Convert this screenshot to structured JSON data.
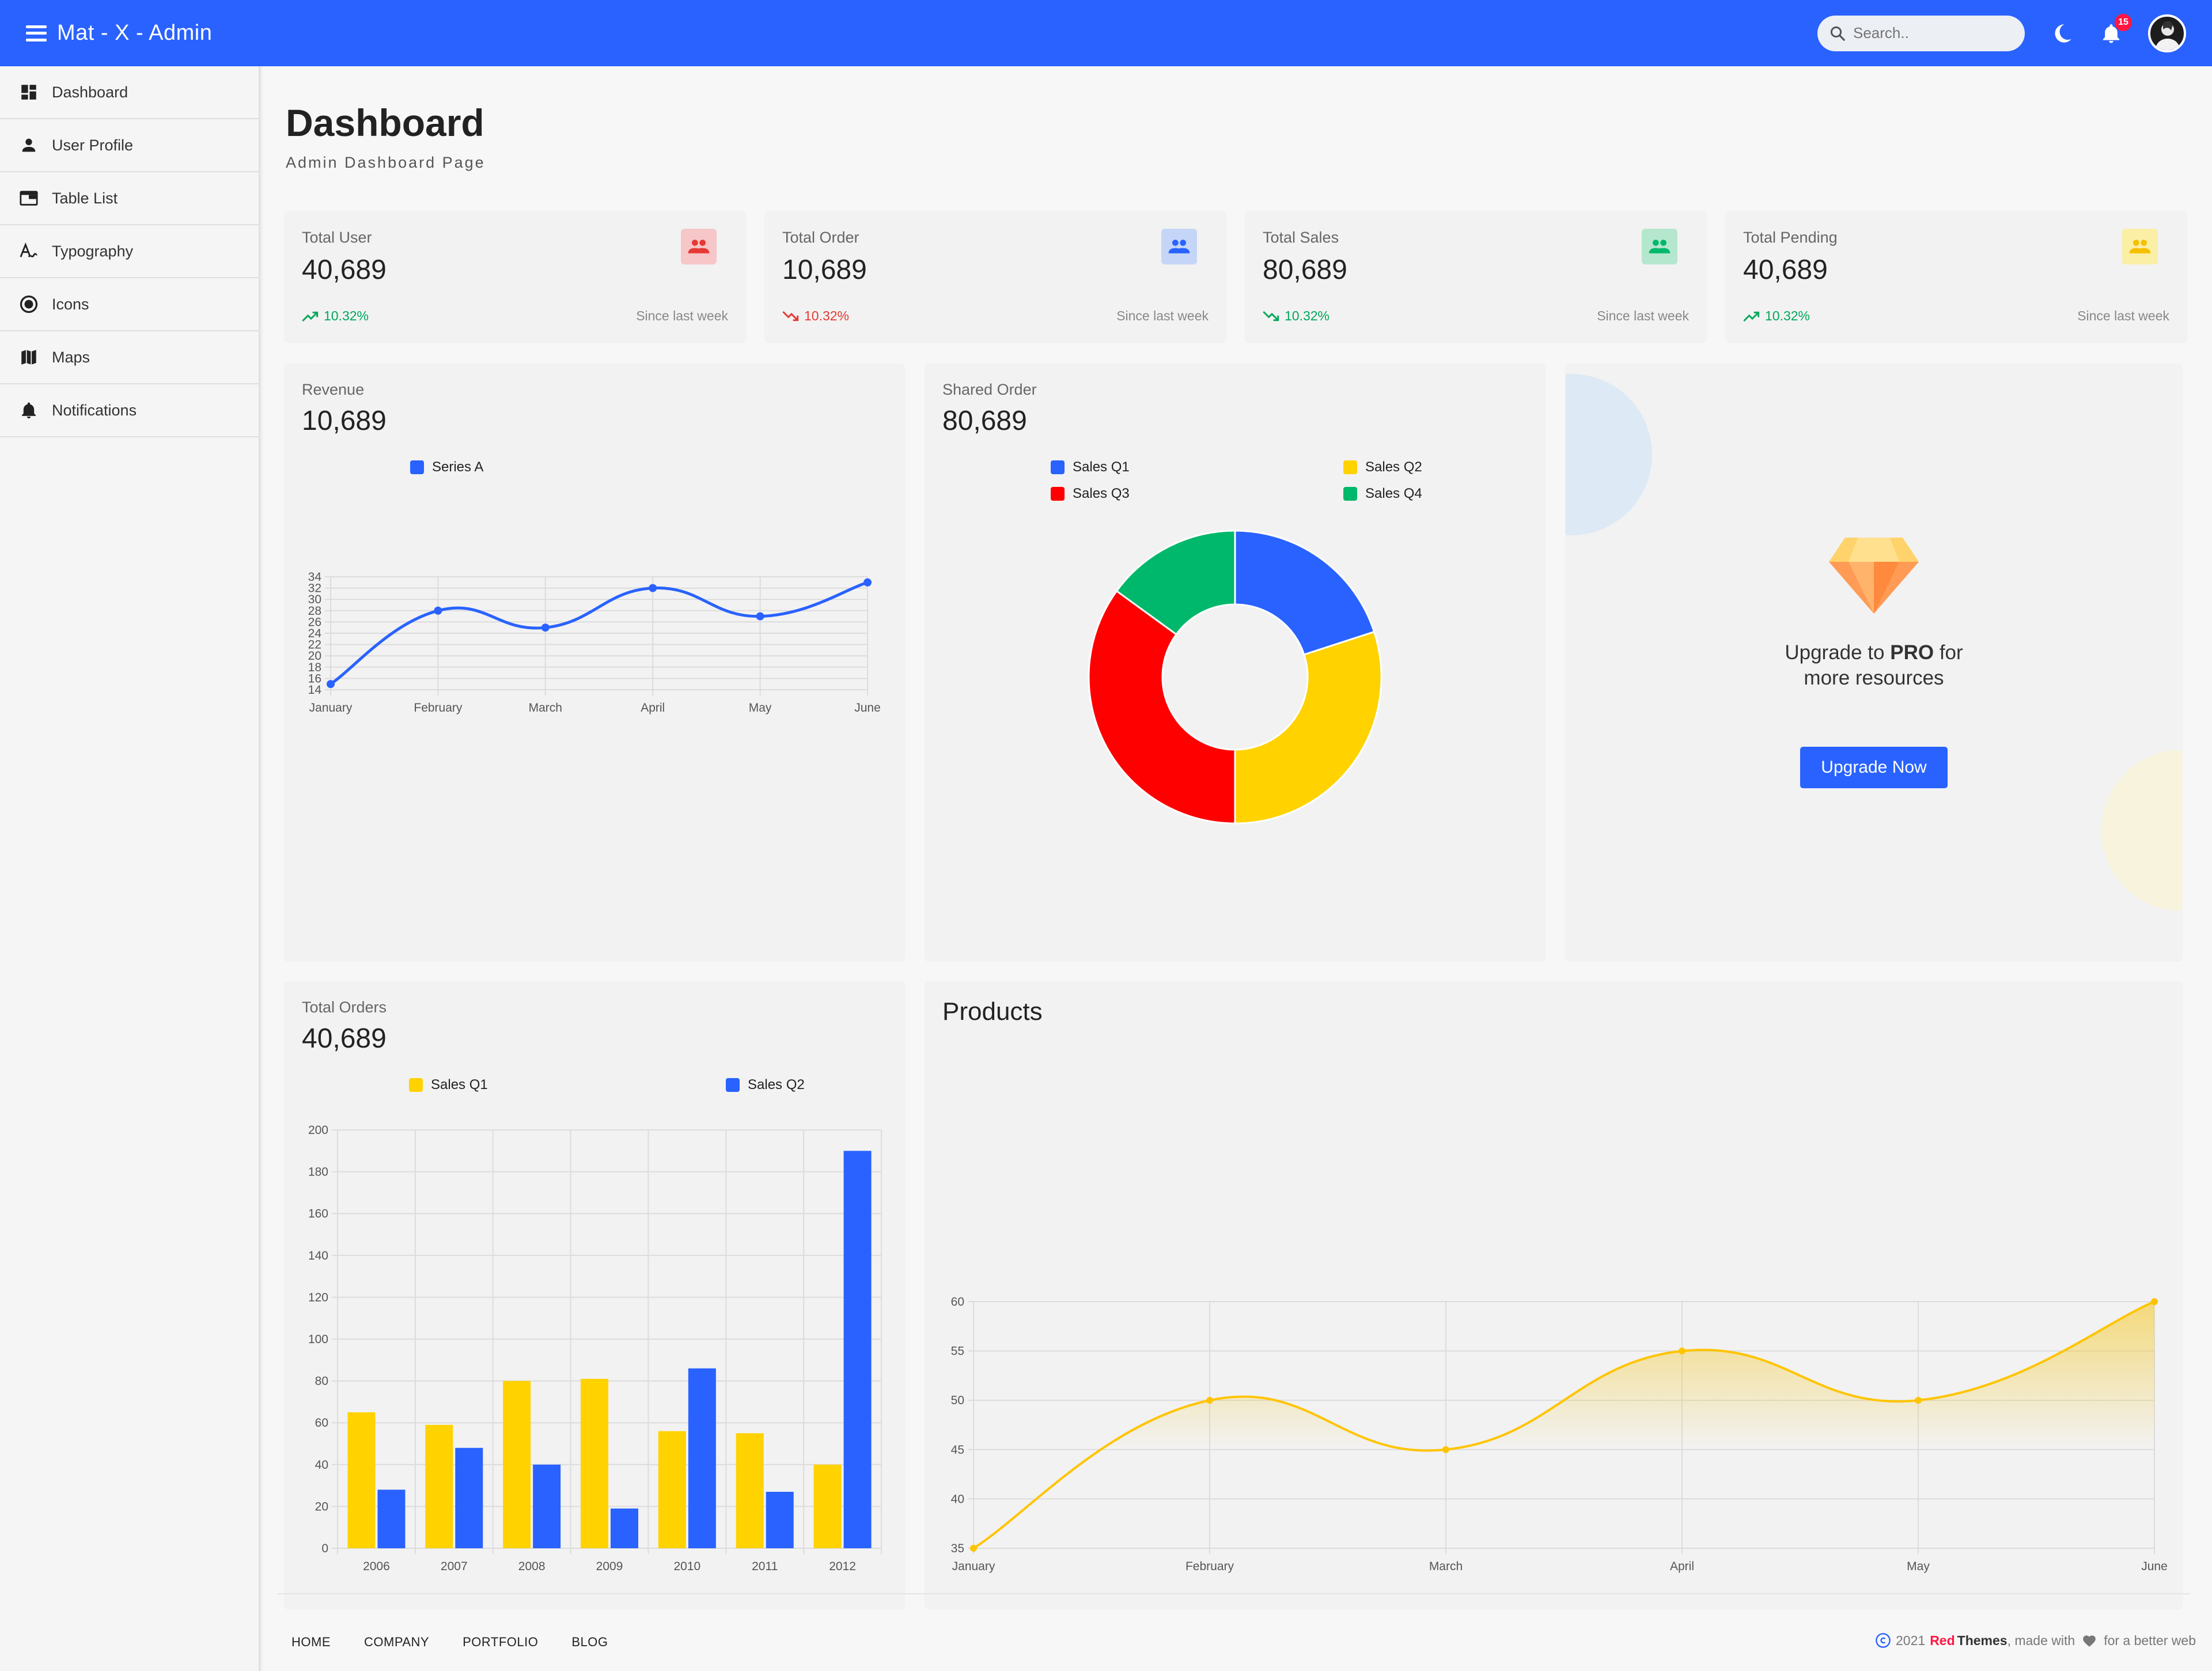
{
  "app": {
    "title": "Mat - X - Admin"
  },
  "search": {
    "placeholder": "Search.."
  },
  "notifications": {
    "count": "15"
  },
  "colors": {
    "primary": "#2962ff",
    "red": "#ff0000",
    "green": "#00b86b",
    "yellow": "#ffd200"
  },
  "sidebar": {
    "items": [
      {
        "label": "Dashboard",
        "icon": "dashboard-icon"
      },
      {
        "label": "User Profile",
        "icon": "person-icon"
      },
      {
        "label": "Table List",
        "icon": "table-icon"
      },
      {
        "label": "Typography",
        "icon": "typography-icon"
      },
      {
        "label": "Icons",
        "icon": "radio-icon"
      },
      {
        "label": "Maps",
        "icon": "map-icon"
      },
      {
        "label": "Notifications",
        "icon": "bell-icon"
      }
    ]
  },
  "page": {
    "title": "Dashboard",
    "subtitle": "Admin Dashboard Page"
  },
  "stats": [
    {
      "label": "Total User",
      "value": "40,689",
      "change": "10.32%",
      "trend": "up",
      "since": "Since last week",
      "icon": "people-icon"
    },
    {
      "label": "Total Order",
      "value": "10,689",
      "change": "10.32%",
      "trend": "down",
      "since": "Since last week",
      "icon": "people-icon"
    },
    {
      "label": "Total Sales",
      "value": "80,689",
      "change": "10.32%",
      "trend": "down",
      "since": "Since last week",
      "icon": "people-icon"
    },
    {
      "label": "Total Pending",
      "value": "40,689",
      "change": "10.32%",
      "trend": "up",
      "since": "Since last week",
      "icon": "people-icon"
    }
  ],
  "revenue": {
    "label": "Revenue",
    "value": "10,689"
  },
  "shared_order": {
    "label": "Shared Order",
    "value": "80,689"
  },
  "total_orders": {
    "label": "Total Orders",
    "value": "40,689"
  },
  "products": {
    "title": "Products"
  },
  "upgrade": {
    "line1_prefix": "Upgrade to ",
    "line1_bold": "PRO",
    "line1_suffix": " for",
    "line2": "more resources",
    "button": "Upgrade Now"
  },
  "footer": {
    "links": [
      "HOME",
      "COMPANY",
      "PORTFOLIO",
      "BLOG"
    ],
    "year": "2021",
    "brand_red": "Red",
    "brand_dark": "Themes",
    "made_with": ", made with",
    "tagline": "for a better web"
  },
  "chart_data": [
    {
      "type": "line",
      "title": "",
      "categories": [
        "January",
        "February",
        "March",
        "April",
        "May",
        "June"
      ],
      "series": [
        {
          "name": "Series A",
          "values": [
            15,
            28,
            25,
            32,
            27,
            33
          ]
        }
      ],
      "ylim": [
        14,
        34
      ],
      "yticks": [
        14,
        16,
        18,
        20,
        22,
        24,
        26,
        28,
        30,
        32,
        34
      ],
      "legend": "top-center",
      "grid": true
    },
    {
      "type": "pie",
      "style": "doughnut",
      "categories": [
        "Sales Q1",
        "Sales Q2",
        "Sales Q3",
        "Sales Q4"
      ],
      "values": [
        20,
        30,
        35,
        15
      ],
      "colors": [
        "#2962ff",
        "#ffd200",
        "#ff0000",
        "#00b86b"
      ],
      "legend": "top"
    },
    {
      "type": "bar",
      "categories": [
        "2006",
        "2007",
        "2008",
        "2009",
        "2010",
        "2011",
        "2012"
      ],
      "series": [
        {
          "name": "Sales Q1",
          "values": [
            65,
            59,
            80,
            81,
            56,
            55,
            40
          ],
          "color": "#ffd200"
        },
        {
          "name": "Sales Q2",
          "values": [
            28,
            48,
            40,
            19,
            86,
            27,
            190
          ],
          "color": "#2962ff"
        }
      ],
      "ylim": [
        0,
        200
      ],
      "yticks": [
        0,
        20,
        40,
        60,
        80,
        100,
        120,
        140,
        160,
        180,
        200
      ],
      "legend": "top",
      "grid": true
    },
    {
      "type": "area",
      "categories": [
        "January",
        "February",
        "March",
        "April",
        "May",
        "June"
      ],
      "series": [
        {
          "values": [
            35,
            50,
            45,
            55,
            50,
            60
          ],
          "color": "#ffc400"
        }
      ],
      "ylim": [
        35,
        60
      ],
      "yticks": [
        35,
        40,
        45,
        50,
        55,
        60
      ],
      "grid": true
    }
  ]
}
